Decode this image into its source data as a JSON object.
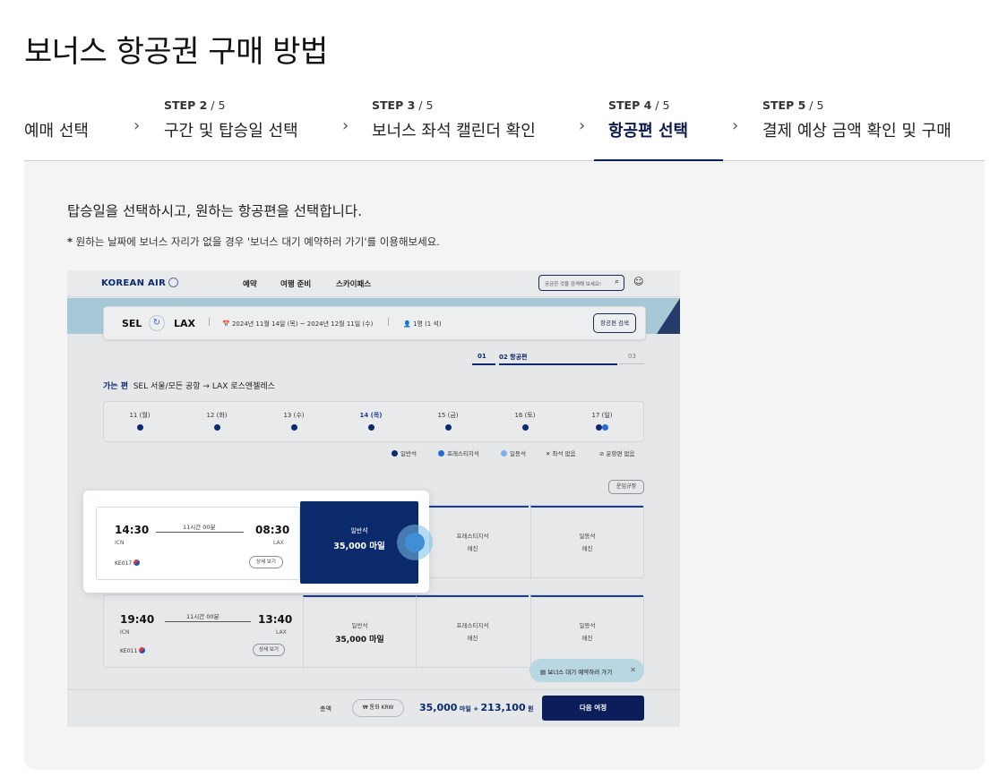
{
  "page_title": "보너스 항공권 구매 방법",
  "steps": [
    {
      "num_bold": "",
      "num_rest": "",
      "label": "예매 선택"
    },
    {
      "num_bold": "STEP 2",
      "num_rest": " / 5",
      "label": "구간 및 탑승일 선택"
    },
    {
      "num_bold": "STEP 3",
      "num_rest": " / 5",
      "label": "보너스 좌석 캘린더 확인"
    },
    {
      "num_bold": "STEP 4",
      "num_rest": " / 5",
      "label": "항공편 선택"
    },
    {
      "num_bold": "STEP 5",
      "num_rest": " / 5",
      "label": "결제 예상 금액 확인 및 구매"
    }
  ],
  "active_step": 4,
  "description": "탑승일을 선택하시고, 원하는 항공편을 선택합니다.",
  "note": {
    "star": "*",
    "text": " 원하는 날짜에 보너스 자리가 없을 경우 '보너스 대기 예약하러 가기'를 이용해보세요."
  },
  "mock": {
    "logo": "KOREAN AIR",
    "nav": [
      "예약",
      "여행 준비",
      "스카이패스"
    ],
    "search_placeholder": "궁금한 것을 검색해 보세요!",
    "route": {
      "from": "SEL",
      "to": "LAX",
      "dates": "2024년 11월 14일 (목) ~ 2024년 12월 11일 (수)",
      "pax": "1명 (1 석)",
      "search_btn": "항공편 검색"
    },
    "progress": {
      "s1": "01",
      "s2": "02 항공편",
      "s3": "03"
    },
    "leg": {
      "label": "가는 편",
      "route": "SEL 서울/모든 공항 → LAX 로스앤젤레스"
    },
    "days": [
      {
        "label": "11 (월)"
      },
      {
        "label": "12 (화)"
      },
      {
        "label": "13 (수)"
      },
      {
        "label": "14 (목)"
      },
      {
        "label": "15 (금)"
      },
      {
        "label": "16 (토)"
      },
      {
        "label": "17 (일)"
      }
    ],
    "legend": [
      "일반석",
      "프레스티지석",
      "일등석",
      "좌석 없음",
      "운항편 없음"
    ],
    "rule_btn": "운임규정",
    "flights": [
      {
        "dep_time": "14:30",
        "dep_apt": "ICN",
        "arr_time": "08:30",
        "arr_apt": "LAX",
        "duration": "11시간 00분",
        "flight_no": "KE017",
        "detail": "상세 보기",
        "economy_label": "일반석",
        "economy_price": "35,000 마일",
        "prestige_label": "프레스티지석",
        "prestige_status": "매진",
        "first_label": "일등석",
        "first_status": "매진"
      },
      {
        "dep_time": "19:40",
        "dep_apt": "ICN",
        "arr_time": "13:40",
        "arr_apt": "LAX",
        "duration": "11시간 00분",
        "flight_no": "KE011",
        "detail": "상세 보기",
        "economy_label": "일반석",
        "economy_price": "35,000 마일",
        "prestige_label": "프레스티지석",
        "prestige_status": "매진",
        "first_label": "일등석",
        "first_status": "매진"
      }
    ],
    "wait_chip": "보너스 대기 예약하러 가기",
    "footer": {
      "total_label": "총액",
      "currency": "통화 KRW",
      "sum": "35,000",
      "sum_unit": " 마일 + ",
      "sum2": "213,100",
      "sum2_unit": " 원",
      "next_btn": "다음 여정"
    }
  },
  "colors": {
    "navy": "#0b1e5b",
    "accent_blue": "#2a6bd8",
    "panel_bg": "#f4f4f4"
  }
}
